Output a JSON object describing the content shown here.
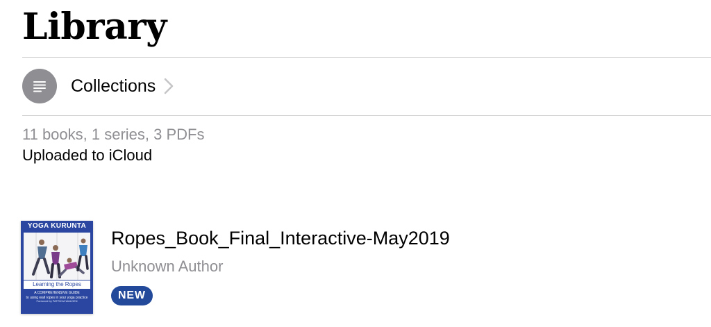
{
  "header": {
    "title": "Library"
  },
  "collections": {
    "label": "Collections",
    "icon": "list-icon",
    "chevron": "chevron-right-icon"
  },
  "summary": {
    "counts": "11 books, 1 series, 3 PDFs",
    "sync_status": "Uploaded to iCloud"
  },
  "books": [
    {
      "title": "Ropes_Book_Final_Interactive-May2019",
      "author": "Unknown Author",
      "badge": "NEW",
      "cover": {
        "title": "YOGA KURUNTA",
        "subtitle": "Learning the Ropes",
        "caption": "A COMPREHENSIVE GUIDE",
        "caption_line2": "to using wall ropes in your yoga practice",
        "foreword": "Foreword by PATRICIA WALDEN",
        "background_color": "#2a46a0"
      }
    }
  ],
  "colors": {
    "accent": "#234a9a",
    "secondary_text": "#8e8e93",
    "icon_circle": "#8e8e93"
  }
}
